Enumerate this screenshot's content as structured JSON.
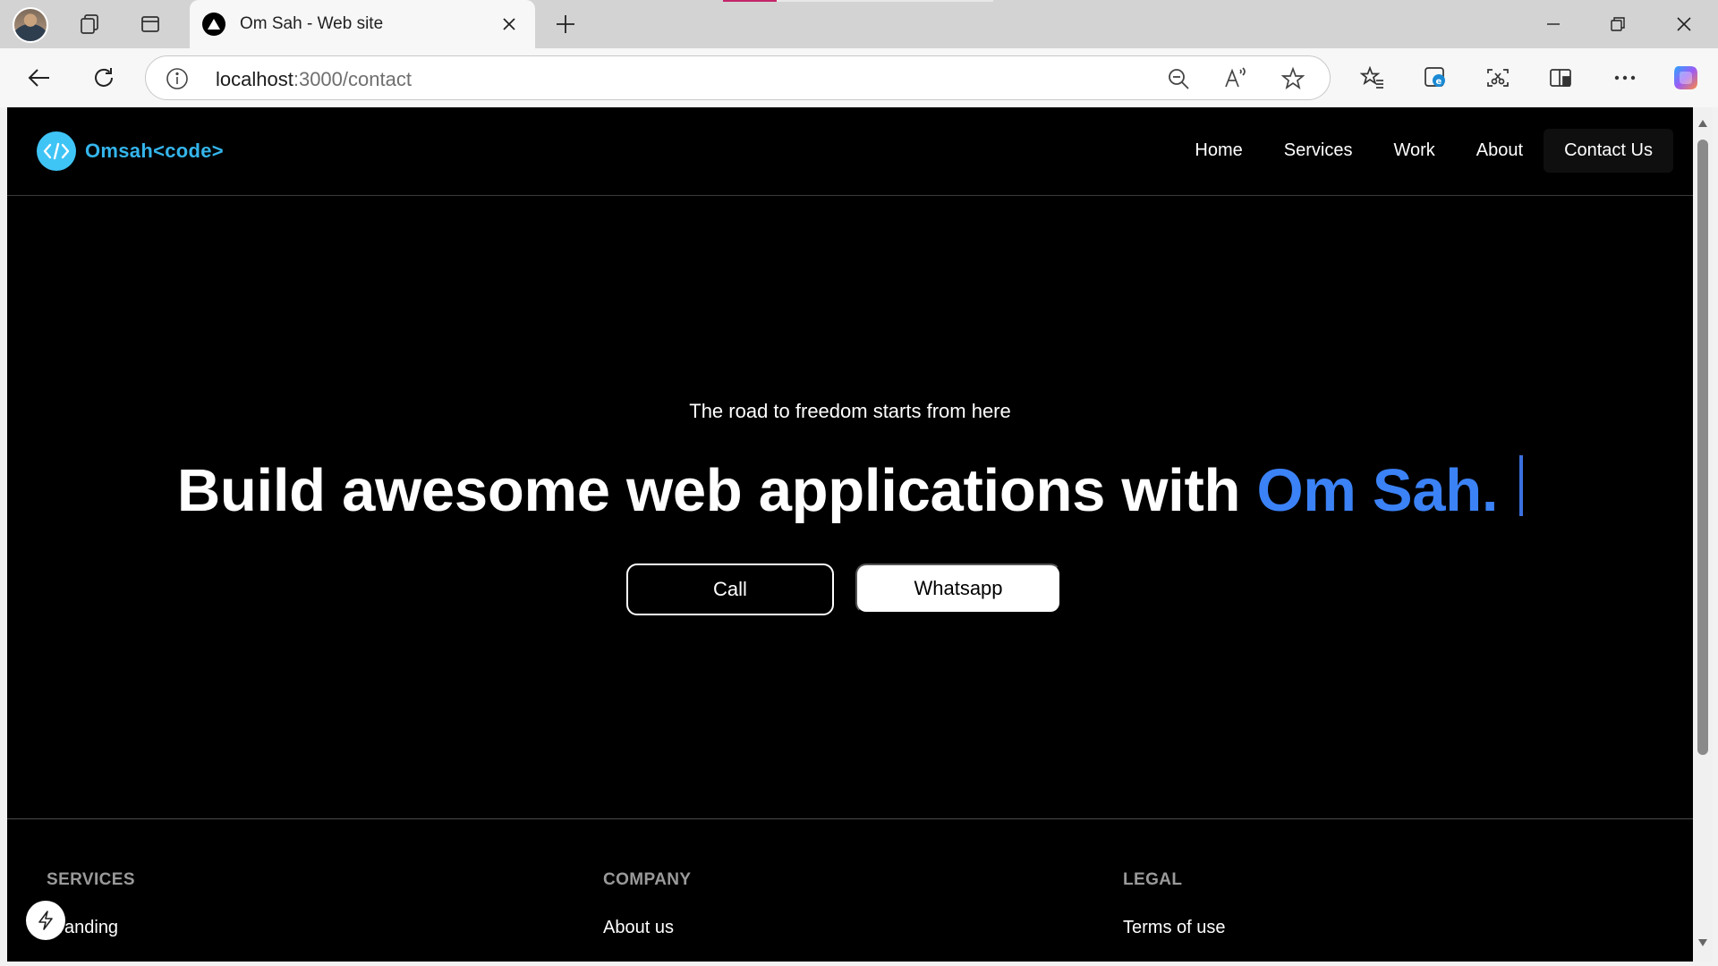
{
  "browser": {
    "tab": {
      "title": "Om Sah - Web site"
    },
    "address": {
      "host": "localhost",
      "path": ":3000/contact"
    }
  },
  "site": {
    "logo_text": "Omsah<code>",
    "nav": [
      {
        "label": "Home"
      },
      {
        "label": "Services"
      },
      {
        "label": "Work"
      },
      {
        "label": "About"
      },
      {
        "label": "Contact Us"
      }
    ]
  },
  "hero": {
    "tagline": "The road to freedom starts from here",
    "headline_main": "Build awesome web applications with ",
    "headline_accent": "Om Sah.",
    "call_label": "Call",
    "whatsapp_label": "Whatsapp"
  },
  "footer": {
    "columns": [
      {
        "heading": "SERVICES",
        "first_link": "Branding"
      },
      {
        "heading": "COMPANY",
        "first_link": "About us"
      },
      {
        "heading": "LEGAL",
        "first_link": "Terms of use"
      }
    ]
  },
  "colors": {
    "page_background": "#000000",
    "accent_blue": "#3b82f6",
    "logo_cyan": "#34b5ec",
    "chrome_gray": "#d3d3d3"
  }
}
